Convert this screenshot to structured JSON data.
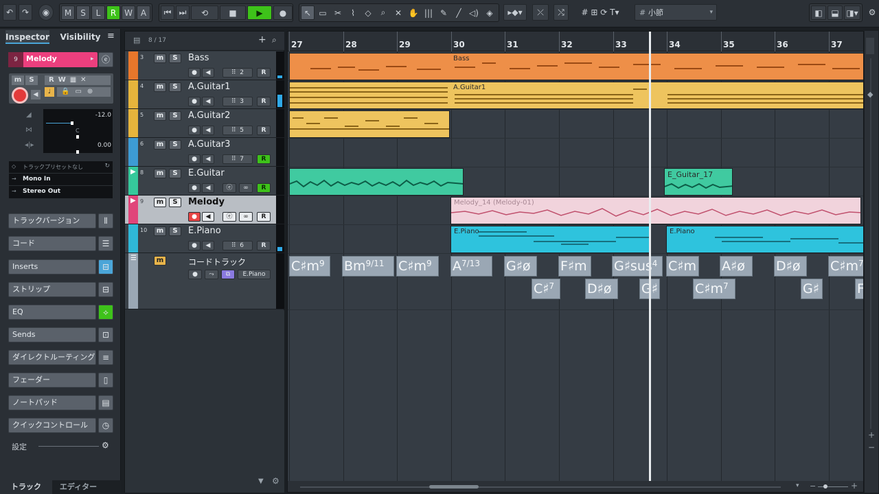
{
  "toolbar": {
    "mode_buttons": [
      "M",
      "S",
      "L",
      "R",
      "W",
      "A"
    ],
    "snap_label": "小節",
    "colors": {
      "green": "#3ec21a",
      "accent": "#4aa5d8"
    }
  },
  "inspector": {
    "tabs": [
      "Inspector",
      "Visibility"
    ],
    "track_number": "9",
    "track_name": "Melody",
    "volume_value": "-12.0",
    "pan_value": "C",
    "delay_value": "0.00",
    "preset_label": "トラックプリセットなし",
    "input_routing": "Mono In",
    "output_routing": "Stereo Out",
    "sections": [
      "トラックバージョン",
      "コード",
      "Inserts",
      "ストリップ",
      "EQ",
      "Sends",
      "ダイレクトルーティング",
      "フェーダー",
      "ノートパッド",
      "クイックコントロール"
    ],
    "settings_label": "設定",
    "bottom_tabs": [
      "トラック",
      "エディター"
    ]
  },
  "tracklist": {
    "counter": "8 / 17",
    "tracks": [
      {
        "num": "3",
        "name": "Bass",
        "channel": "2",
        "color": "#e8772b"
      },
      {
        "num": "4",
        "name": "A.Guitar1",
        "channel": "3",
        "color": "#e6b43c"
      },
      {
        "num": "5",
        "name": "A.Guitar2",
        "channel": "5",
        "color": "#e6b43c"
      },
      {
        "num": "6",
        "name": "A.Guitar3",
        "channel": "7",
        "color": "#3d9bd4"
      },
      {
        "num": "8",
        "name": "E.Guitar",
        "channel": "",
        "color": "#36c99b"
      },
      {
        "num": "9",
        "name": "Melody",
        "channel": "",
        "color": "#e0457a"
      },
      {
        "num": "10",
        "name": "E.Piano",
        "channel": "6",
        "color": "#2fb8d8"
      }
    ],
    "chord_track": {
      "name": "コードトラック",
      "instrument": "E.Piano"
    },
    "labels": {
      "m": "m",
      "s": "S",
      "r": "R"
    }
  },
  "arrange": {
    "bars": [
      "27",
      "28",
      "29",
      "30",
      "31",
      "32",
      "33",
      "34",
      "35",
      "36",
      "37"
    ],
    "parts": {
      "bass": "Bass",
      "aguitar1": "A.Guitar1",
      "eguitar": "E_Guitar_17",
      "melody": "Melody_14 (Melody-01)",
      "epiano": "E.Piano"
    },
    "chords_top": [
      {
        "root": "C♯m",
        "ext": "9"
      },
      {
        "root": "Bm",
        "ext": "9/11"
      },
      {
        "root": "C♯m",
        "ext": "9"
      },
      {
        "root": "A",
        "ext": "7/13"
      },
      {
        "root": "G♯ø",
        "ext": ""
      },
      {
        "root": "F♯m",
        "ext": ""
      },
      {
        "root": "G♯sus",
        "ext": "4"
      },
      {
        "root": "C♯m",
        "ext": ""
      },
      {
        "root": "A♯ø",
        "ext": ""
      },
      {
        "root": "D♯ø",
        "ext": ""
      },
      {
        "root": "C♯m",
        "ext": "7"
      }
    ],
    "chords_bottom": [
      {
        "root": "C♯",
        "ext": "7"
      },
      {
        "root": "D♯ø",
        "ext": ""
      },
      {
        "root": "G♯",
        "ext": ""
      },
      {
        "root": "C♯m",
        "ext": "7"
      },
      {
        "root": "G♯",
        "ext": ""
      },
      {
        "root": "F",
        "ext": ""
      }
    ]
  }
}
